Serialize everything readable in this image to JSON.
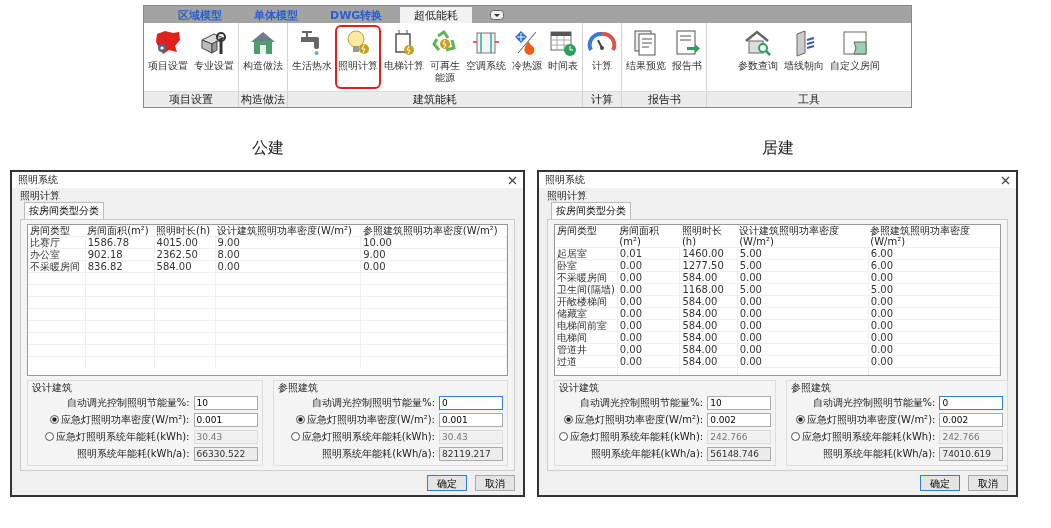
{
  "ribbon": {
    "tabs": [
      {
        "label": "区域模型",
        "selected": false
      },
      {
        "label": "单体模型",
        "selected": false
      },
      {
        "label": "DWG转换",
        "selected": false
      },
      {
        "label": "超低能耗",
        "selected": true
      }
    ],
    "groups": [
      {
        "label": "项目设置",
        "buttons": [
          {
            "label": "项目设置",
            "selected": false
          },
          {
            "label": "专业设置",
            "selected": false
          }
        ]
      },
      {
        "label": "构造做法",
        "buttons": [
          {
            "label": "构造做法",
            "selected": false
          }
        ]
      },
      {
        "label": "建筑能耗",
        "buttons": [
          {
            "label": "生活热水",
            "selected": false
          },
          {
            "label": "照明计算",
            "selected": true
          },
          {
            "label": "电梯计算",
            "selected": false
          },
          {
            "label": "可再生",
            "label_line_2": "能源",
            "selected": false
          },
          {
            "label": "空调系统",
            "selected": false
          },
          {
            "label": "冷热源",
            "selected": false
          },
          {
            "label": "时间表",
            "selected": false
          }
        ]
      },
      {
        "label": "计算",
        "buttons": [
          {
            "label": "计算",
            "selected": false
          }
        ]
      },
      {
        "label": "报告书",
        "buttons": [
          {
            "label": "结果预览",
            "selected": false
          },
          {
            "label": "报告书",
            "selected": false
          }
        ]
      },
      {
        "label": "工具",
        "buttons": [
          {
            "label": "参数查询",
            "selected": false
          },
          {
            "label": "墙线朝向",
            "selected": false
          },
          {
            "label": "自定义房间",
            "selected": false
          }
        ]
      }
    ]
  },
  "dialogs": [
    {
      "caption": "公建",
      "title": "照明系统",
      "group_label": "照明计算",
      "tab": {
        "label": "按房间类型分类",
        "selected": true
      },
      "columns": [
        "房间类型",
        "房间面积(m²)",
        "照明时长(h)",
        "设计建筑照明功率密度(W/m²)",
        "参照建筑照明功率密度(W/m²)"
      ],
      "rows": [
        [
          "比赛厅",
          "1586.78",
          "4015.00",
          "9.00",
          "10.00"
        ],
        [
          "办公室",
          "902.18",
          "2362.50",
          "8.00",
          "9.00"
        ],
        [
          "不采暖房间",
          "836.82",
          "584.00",
          "0.00",
          "0.00"
        ]
      ],
      "panels": [
        {
          "title": "设计建筑",
          "fields": [
            {
              "kind": "input",
              "label": "自动调光控制照明节能量%:",
              "value": "10",
              "focused": false
            },
            {
              "kind": "radio",
              "label": "应急灯照明功率密度(W/m²):",
              "value": "0.001",
              "selected": true
            },
            {
              "kind": "radio",
              "label": "应急灯照明系统年能耗(kWh):",
              "value": "30.43",
              "selected": false
            },
            {
              "kind": "output",
              "label": "照明系统年能耗(kWh/a):",
              "value": "66330.522"
            }
          ]
        },
        {
          "title": "参照建筑",
          "fields": [
            {
              "kind": "input",
              "label": "自动调光控制照明节能量%:",
              "value": "0",
              "focused": true
            },
            {
              "kind": "radio",
              "label": "应急灯照明功率密度(W/m²):",
              "value": "0.001",
              "selected": true
            },
            {
              "kind": "radio",
              "label": "应急灯照明系统年能耗(kWh):",
              "value": "30.43",
              "selected": false
            },
            {
              "kind": "output",
              "label": "照明系统年能耗(kWh/a):",
              "value": "82119.217"
            }
          ]
        }
      ],
      "buttons": [
        {
          "label": "确定",
          "default": true
        },
        {
          "label": "取消",
          "default": false
        }
      ]
    },
    {
      "caption": "居建",
      "title": "照明系统",
      "group_label": "照明计算",
      "tab": {
        "label": "按房间类型分类",
        "selected": true
      },
      "columns": [
        "房间类型",
        "房间面积(m²)",
        "照明时长(h)",
        "设计建筑照明功率密度(W/m²)",
        "参照建筑照明功率密度(W/m²)"
      ],
      "rows": [
        [
          "起居室",
          "0.01",
          "1460.00",
          "5.00",
          "6.00"
        ],
        [
          "卧室",
          "0.00",
          "1277.50",
          "5.00",
          "6.00"
        ],
        [
          "不采暖房间",
          "0.00",
          "584.00",
          "0.00",
          "0.00"
        ],
        [
          "卫生间(隔墙)",
          "0.00",
          "1168.00",
          "5.00",
          "5.00"
        ],
        [
          "开敞楼梯间",
          "0.00",
          "584.00",
          "0.00",
          "0.00"
        ],
        [
          "储藏室",
          "0.00",
          "584.00",
          "0.00",
          "0.00"
        ],
        [
          "电梯间前室",
          "0.00",
          "584.00",
          "0.00",
          "0.00"
        ],
        [
          "电梯间",
          "0.00",
          "584.00",
          "0.00",
          "0.00"
        ],
        [
          "管道井",
          "0.00",
          "584.00",
          "0.00",
          "0.00"
        ],
        [
          "过道",
          "0.00",
          "584.00",
          "0.00",
          "0.00"
        ]
      ],
      "panels": [
        {
          "title": "设计建筑",
          "fields": [
            {
              "kind": "input",
              "label": "自动调光控制照明节能量%:",
              "value": "10",
              "focused": false
            },
            {
              "kind": "radio",
              "label": "应急灯照明功率密度(W/m²):",
              "value": "0.002",
              "selected": true
            },
            {
              "kind": "radio",
              "label": "应急灯照明系统年能耗(kWh):",
              "value": "242.766",
              "selected": false
            },
            {
              "kind": "output",
              "label": "照明系统年能耗(kWh/a):",
              "value": "56148.746"
            }
          ]
        },
        {
          "title": "参照建筑",
          "fields": [
            {
              "kind": "input",
              "label": "自动调光控制照明节能量%:",
              "value": "0",
              "focused": true
            },
            {
              "kind": "radio",
              "label": "应急灯照明功率密度(W/m²):",
              "value": "0.002",
              "selected": true
            },
            {
              "kind": "radio",
              "label": "应急灯照明系统年能耗(kWh):",
              "value": "242.766",
              "selected": false
            },
            {
              "kind": "output",
              "label": "照明系统年能耗(kWh/a):",
              "value": "74010.619"
            }
          ]
        }
      ],
      "buttons": [
        {
          "label": "确定",
          "default": true
        },
        {
          "label": "取消",
          "default": false
        }
      ]
    }
  ]
}
